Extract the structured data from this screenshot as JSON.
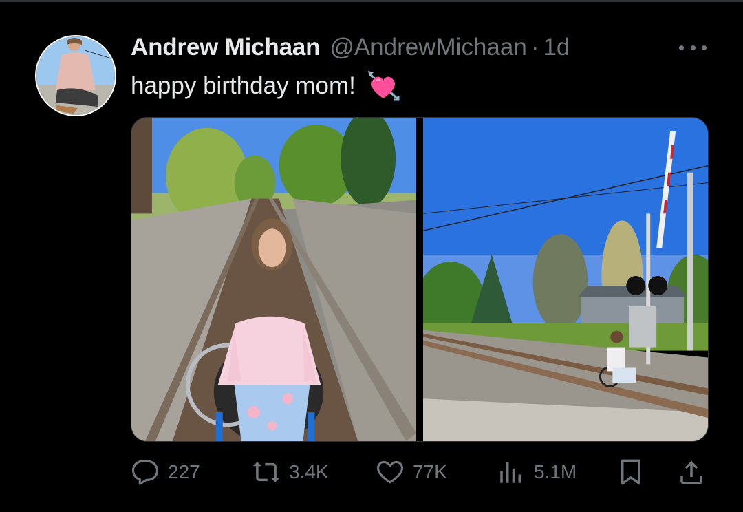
{
  "tweet": {
    "author": {
      "display_name": "Andrew Michaan",
      "handle": "@AndrewMichaan",
      "avatar_icon": "avatar-photo"
    },
    "separator": "·",
    "time": "1d",
    "text": "happy birthday mom!",
    "emoji_icon": "heart-with-arrow-icon",
    "media": [
      {
        "name": "photo-woman-wheelchair-on-tracks"
      },
      {
        "name": "photo-woman-wheelchair-at-crossing"
      }
    ],
    "stats": {
      "replies": "227",
      "reposts": "3.4K",
      "likes": "77K",
      "views": "5.1M"
    }
  },
  "colors": {
    "background": "#000000",
    "text": "#e7e9ea",
    "muted": "#71767b",
    "heart_emoji": "#ff4f9a"
  }
}
